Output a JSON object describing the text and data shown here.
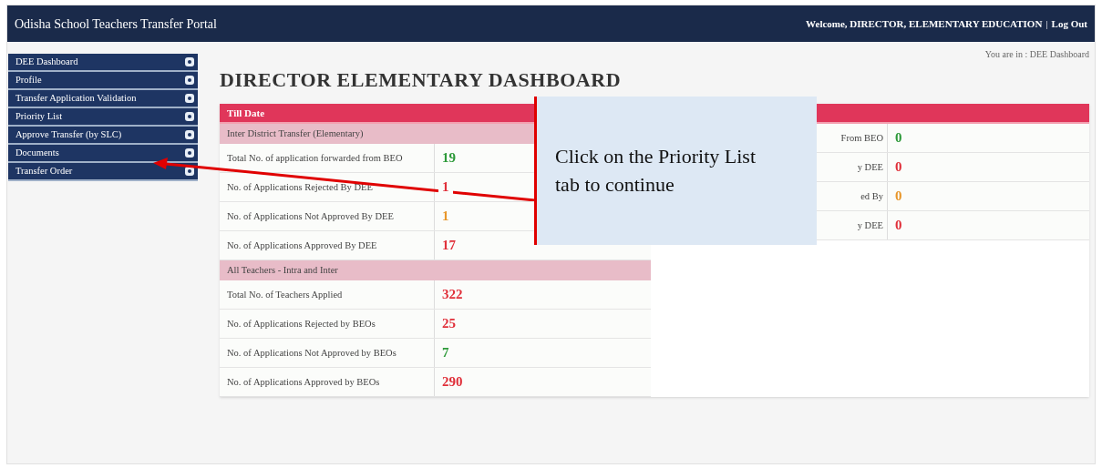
{
  "header": {
    "title": "Odisha School Teachers Transfer Portal",
    "welcome": "Welcome, DIRECTOR, ELEMENTARY EDUCATION",
    "separator": "|",
    "logout": "Log Out"
  },
  "breadcrumb": "You are in : DEE Dashboard",
  "sidebar": {
    "items": [
      {
        "label": "DEE Dashboard"
      },
      {
        "label": "Profile"
      },
      {
        "label": "Transfer Application Validation"
      },
      {
        "label": "Priority List"
      },
      {
        "label": "Approve Transfer (by SLC)"
      },
      {
        "label": "Documents"
      },
      {
        "label": "Transfer Order"
      }
    ]
  },
  "page_title": "DIRECTOR ELEMENTARY DASHBOARD",
  "table": {
    "header": "Till Date",
    "sections": [
      {
        "title": "Inter District Transfer (Elementary)",
        "rows": [
          {
            "label": "Total No. of application forwarded from BEO",
            "value": "19",
            "color": "#2e9a3a"
          },
          {
            "label": "No. of Applications Rejected By DEE",
            "value": "1",
            "color": "#e0303a"
          },
          {
            "label": "No. of Applications Not Approved By DEE",
            "value": "1",
            "color": "#e8962a"
          },
          {
            "label": "No. of Applications Approved By DEE",
            "value": "17",
            "color": "#e0303a"
          }
        ]
      },
      {
        "title": "All Teachers - Intra and Inter",
        "rows": [
          {
            "label": "Total No. of Teachers Applied",
            "value": "322",
            "color": "#e0303a"
          },
          {
            "label": "No. of Applications Rejected by BEOs",
            "value": "25",
            "color": "#e0303a"
          },
          {
            "label": "No. of Applications Not Approved by BEOs",
            "value": "7",
            "color": "#2e9a3a"
          },
          {
            "label": "No. of Applications Approved by BEOs",
            "value": "290",
            "color": "#e0303a"
          }
        ]
      }
    ]
  },
  "right_table": {
    "rows": [
      {
        "label": "From BEO",
        "value": "0",
        "color": "#2e9a3a"
      },
      {
        "label": "y DEE",
        "value": "0",
        "color": "#e0303a"
      },
      {
        "label": "ed By",
        "value": "0",
        "color": "#e8962a"
      },
      {
        "label": "y DEE",
        "value": "0",
        "color": "#e0303a"
      }
    ]
  },
  "callout": {
    "text": "Click on the Priority List tab to continue"
  }
}
